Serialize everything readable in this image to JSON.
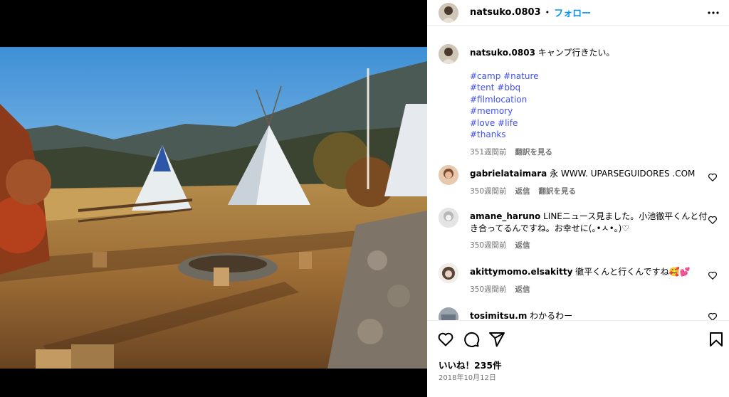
{
  "post": {
    "username": "natsuko.0803",
    "follow_label": "フォロー",
    "separator": "•"
  },
  "caption": {
    "username": "natsuko.0803",
    "text": "キャンプ行きたい。",
    "hashtags": [
      "#camp #nature",
      "#tent #bbq",
      "#filmlocation",
      "#memory",
      "#love #life",
      "#thanks"
    ],
    "time": "351週間前",
    "translate_label": "翻訳を見る"
  },
  "comments": [
    {
      "username": "gabrielataimara",
      "text": "永 WWW. UPARSEGUIDORES .COM",
      "time": "350週間前",
      "reply_label": "返信",
      "translate_label": "翻訳を見る"
    },
    {
      "username": "amane_haruno",
      "text": "LINEニュース見ました。小池徹平くんと付き合ってるんですね。お幸せに(｡•ㅅ•｡)♡",
      "time": "350週間前",
      "reply_label": "返信"
    },
    {
      "username": "akittymomo.elsakitty",
      "text": "徹平くんと行くんですね🥰💕",
      "time": "350週間前",
      "reply_label": "返信"
    },
    {
      "username": "tosimitsu.m",
      "text": "わかるわー"
    }
  ],
  "footer": {
    "likes": "いいね！235件",
    "date": "2018年10月12日"
  },
  "icons": {
    "like": "heart-icon",
    "comment": "comment-icon",
    "share": "share-icon",
    "save": "bookmark-icon",
    "more": "more-icon"
  },
  "colors": {
    "accent": "#0095f6",
    "hashtag": "#4150f7",
    "meta": "#737373"
  }
}
